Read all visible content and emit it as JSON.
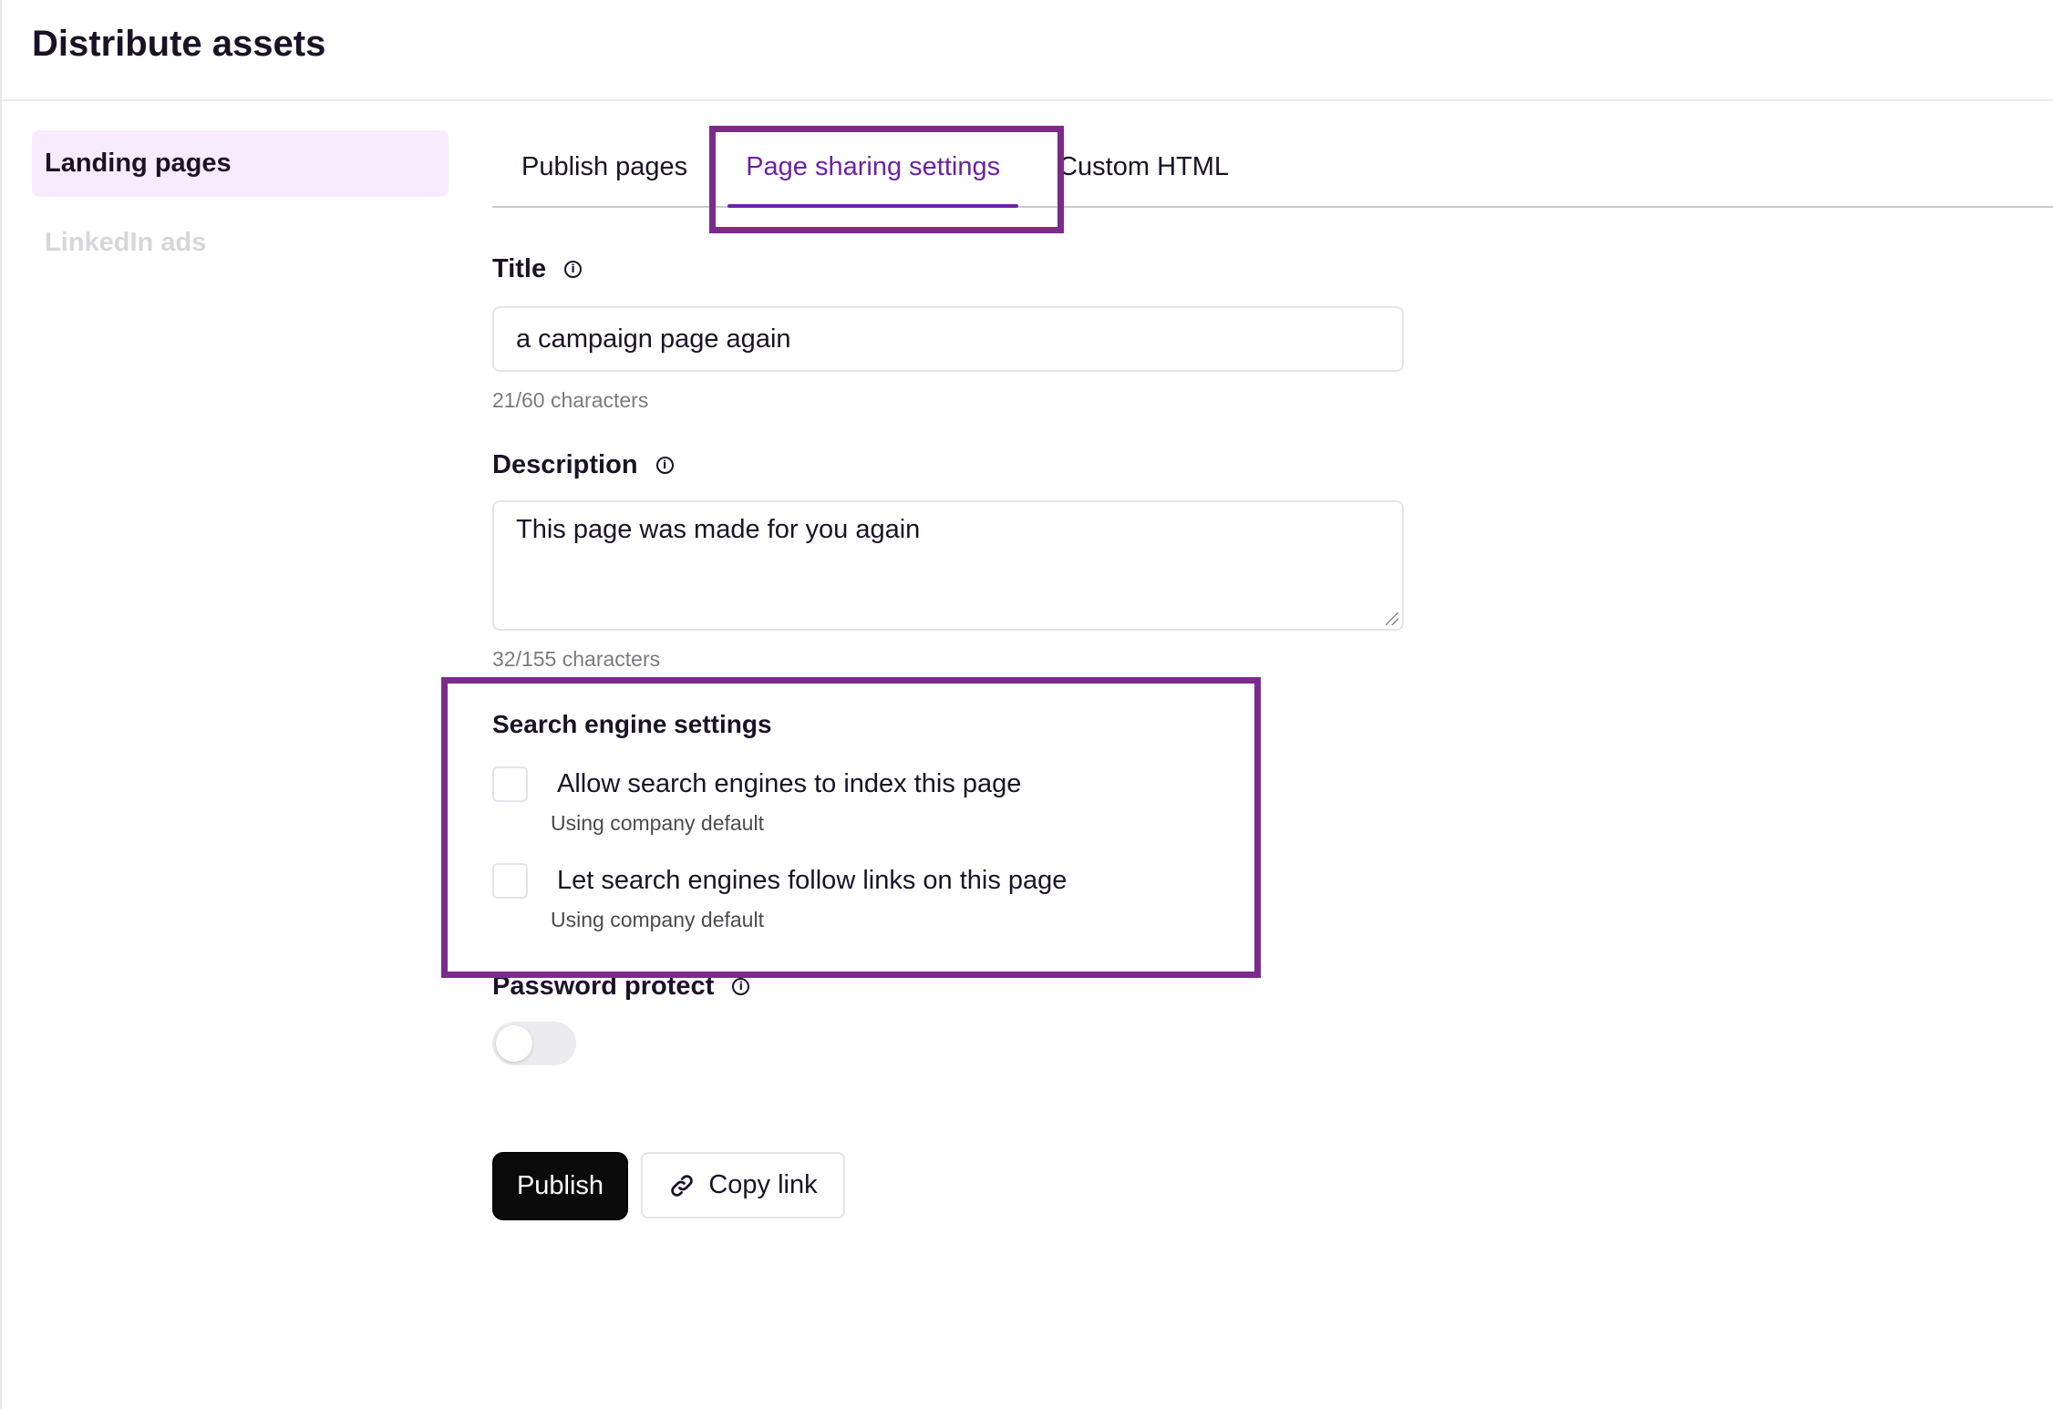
{
  "header": {
    "title": "Distribute assets"
  },
  "sidebar": {
    "items": [
      {
        "label": "Landing pages",
        "state": "active"
      },
      {
        "label": "LinkedIn ads",
        "state": "disabled"
      }
    ]
  },
  "tabs": [
    {
      "label": "Publish pages",
      "active": false
    },
    {
      "label": "Page sharing settings",
      "active": true
    },
    {
      "label": "Custom HTML",
      "active": false
    }
  ],
  "form": {
    "title": {
      "label": "Title",
      "value": "a campaign page again",
      "counter": "21/60 characters"
    },
    "description": {
      "label": "Description",
      "value": "This page was made for you again",
      "counter": "32/155 characters"
    },
    "search_engine": {
      "title": "Search engine settings",
      "options": [
        {
          "label": "Allow search engines to index this page",
          "help": "Using company default",
          "checked": false
        },
        {
          "label": "Let search engines follow links on this page",
          "help": "Using company default",
          "checked": false
        }
      ]
    },
    "password": {
      "label": "Password protect",
      "enabled": false
    }
  },
  "actions": {
    "publish_label": "Publish",
    "copy_link_label": "Copy link"
  },
  "colors": {
    "accent": "#6b21a8",
    "highlight": "#7c2b8c",
    "sidebar_active_bg": "#f7ebfd"
  },
  "icons": {
    "info": "info-icon",
    "link": "link-icon"
  }
}
